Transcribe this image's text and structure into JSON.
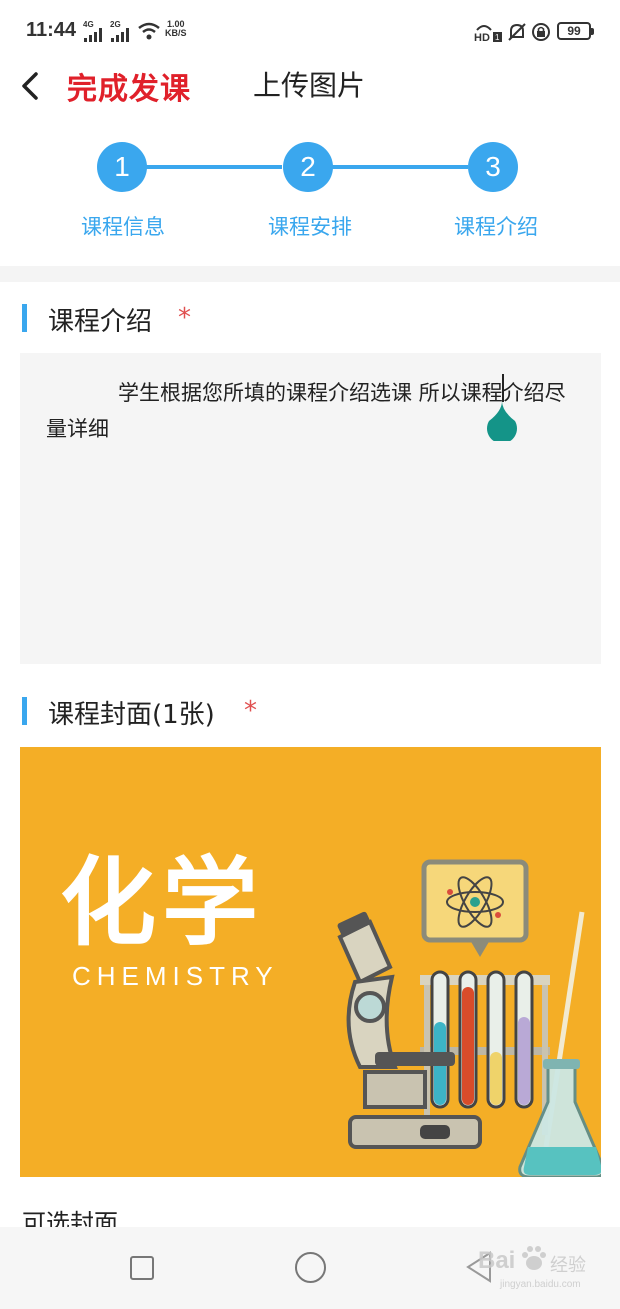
{
  "status_bar": {
    "time": "11:44",
    "signal1_label": "4G",
    "signal2_label": "2G",
    "speed_value": "1.00",
    "speed_unit": "KB/S",
    "hd_label": "HD",
    "hd_sub": "1",
    "battery": "99"
  },
  "header": {
    "app_title": "完成发课",
    "page_title": "上传图片"
  },
  "steps": [
    {
      "number": "1",
      "label": "课程信息"
    },
    {
      "number": "2",
      "label": "课程安排"
    },
    {
      "number": "3",
      "label": "课程介绍"
    }
  ],
  "intro_section": {
    "title": "课程介绍",
    "required_mark": "*",
    "placeholder": "学生根据您所填的课程介绍选课 所以课程介绍尽量详细"
  },
  "cover_section": {
    "title": "课程封面(1张)",
    "required_mark": "*",
    "cover_title": "化学",
    "cover_subtitle": "CHEMISTRY"
  },
  "optional_cover_label": "可选封面",
  "watermark": {
    "brand": "Bai",
    "brand_cn": "经验",
    "url": "jingyan.baidu.com"
  },
  "colors": {
    "accent": "#3aa7ee",
    "title_red": "#e0202a",
    "required_red": "#e05050",
    "cover_bg": "#f4ae26",
    "textarea_bg": "#f5f5f5"
  }
}
